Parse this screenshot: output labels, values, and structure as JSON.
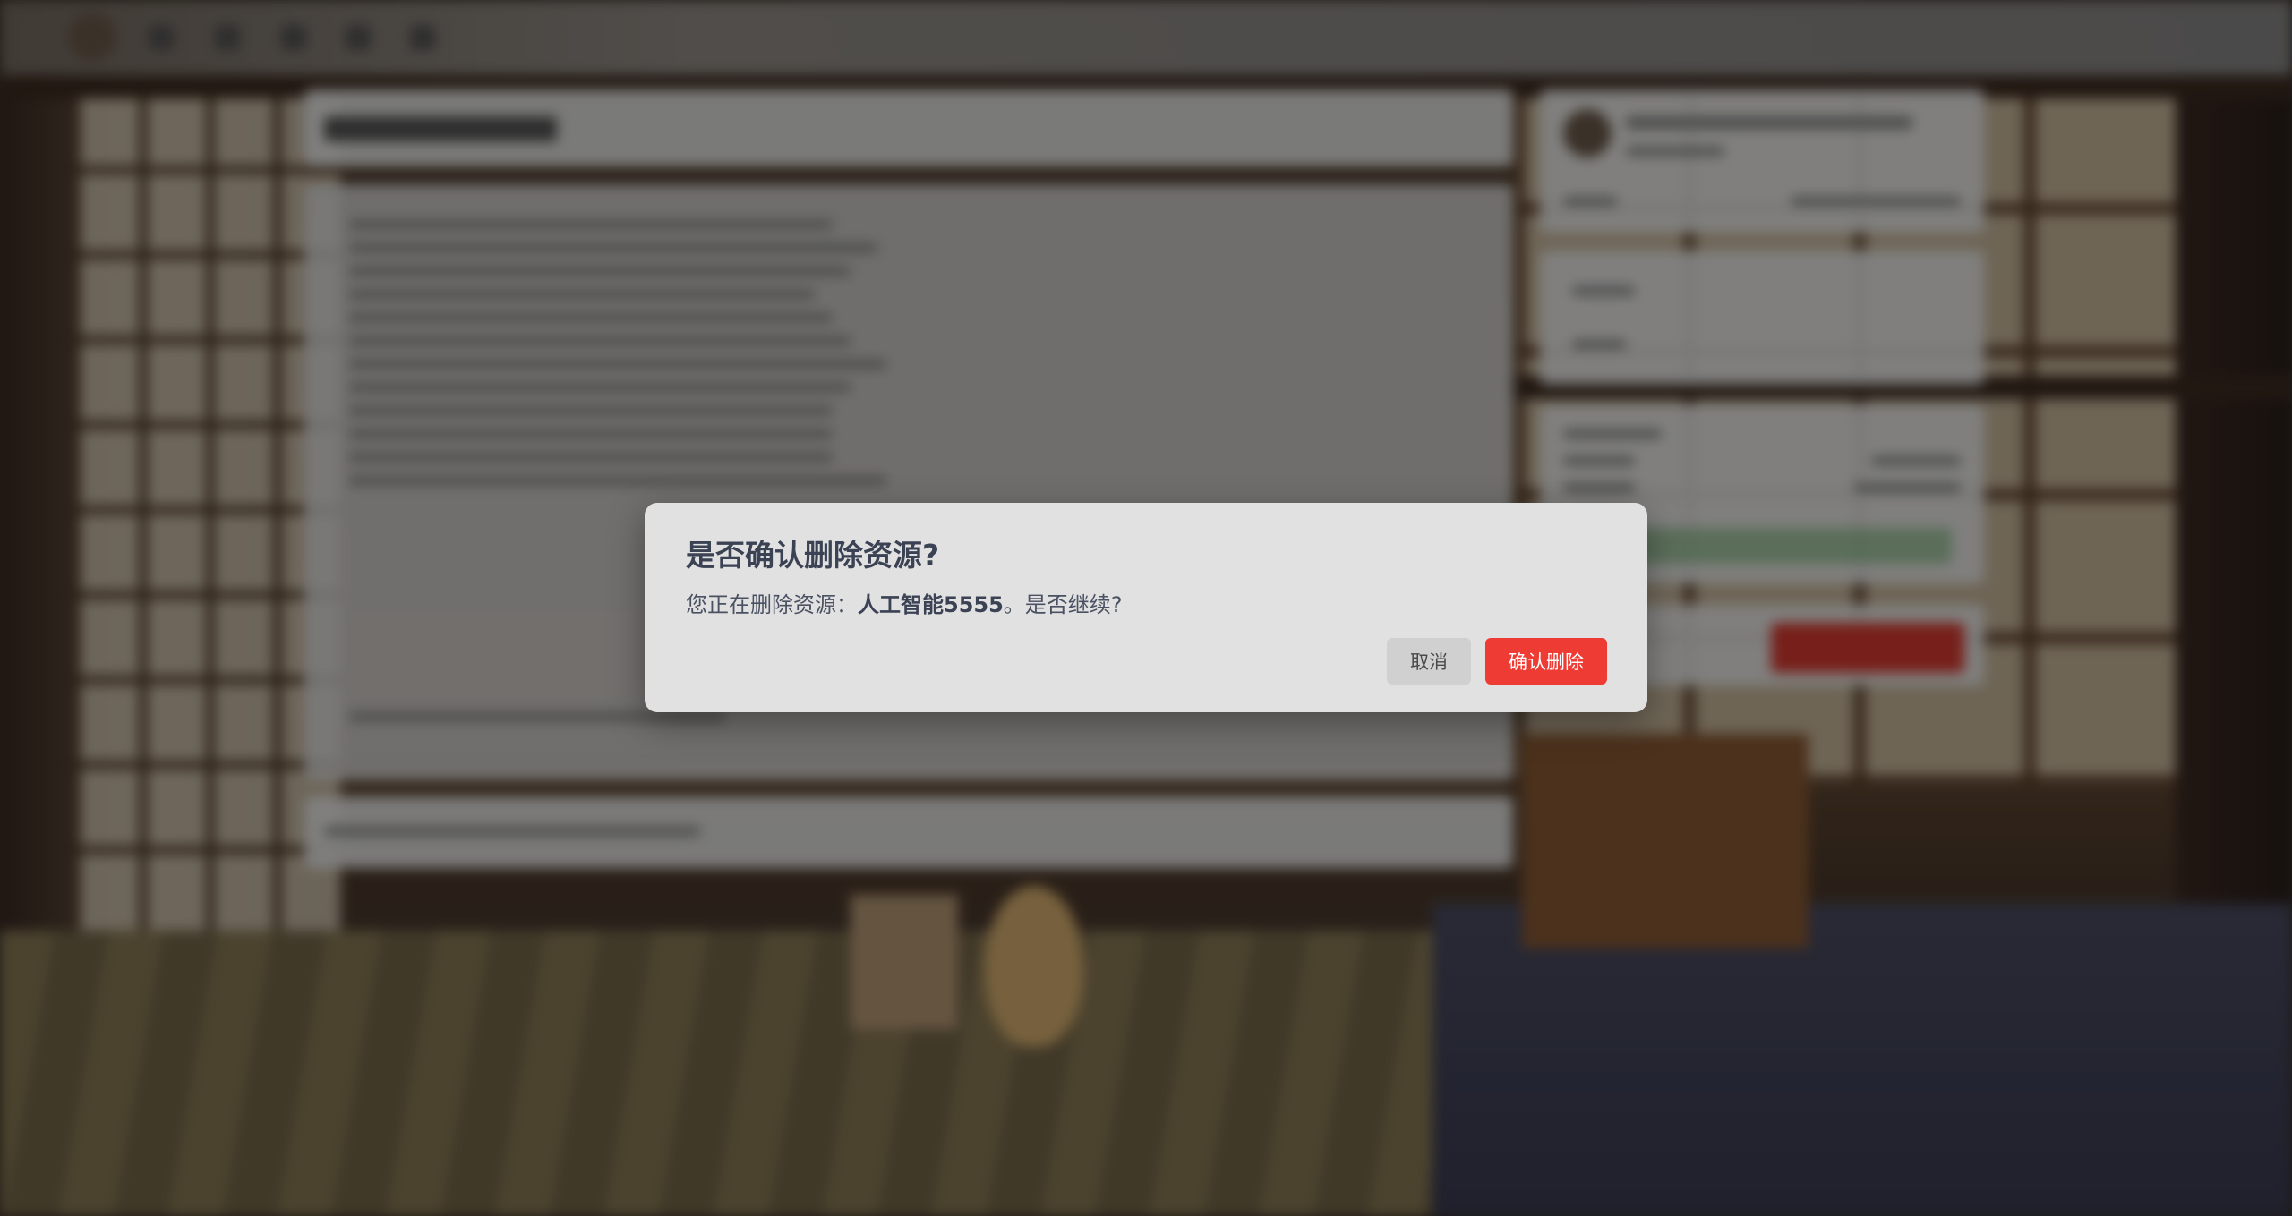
{
  "dialog": {
    "title": "是否确认删除资源?",
    "message_prefix": "您正在删除资源：",
    "resource_name": "人工智能5555",
    "message_suffix": "。是否继续?",
    "cancel_label": "取消",
    "confirm_label": "确认删除"
  },
  "colors": {
    "overlay": "rgba(0,0,0,0.45)",
    "dialog_bg": "#e1e1e1",
    "title_text": "#3b4254",
    "confirm_button": "#ee3b34",
    "cancel_button": "#d0d0d0"
  }
}
